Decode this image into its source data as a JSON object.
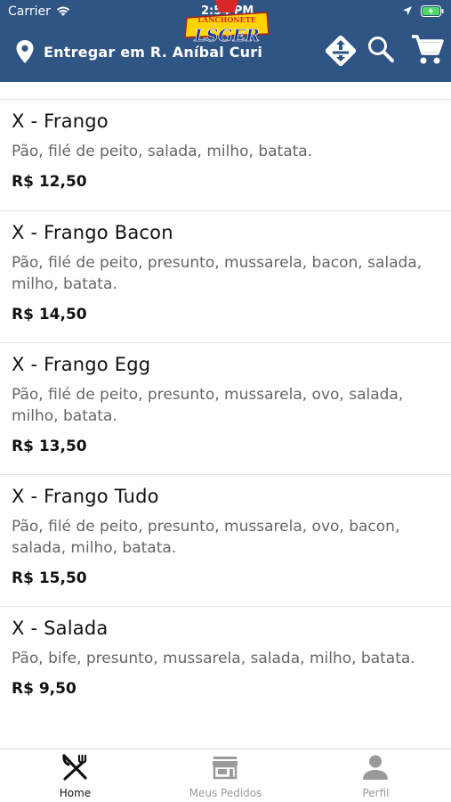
{
  "status_bar": {
    "carrier": "Carrier",
    "time": "2:54 PM"
  },
  "brand": {
    "logo_top": "LANCHONETE",
    "logo_bottom": "LSGER",
    "accent": "#2f5584",
    "logo_red": "#d62828",
    "logo_yellow": "#ffd400"
  },
  "header": {
    "address": "Entregar em R. Aníbal Curi"
  },
  "items": [
    {
      "title": "X - Frango",
      "desc": "Pão, filé de peito, salada, milho, batata.",
      "price": "R$ 12,50"
    },
    {
      "title": "X - Frango Bacon",
      "desc": "Pão, filé de peito, presunto, mussarela, bacon, salada, milho, batata.",
      "price": "R$ 14,50"
    },
    {
      "title": "X - Frango Egg",
      "desc": "Pão, filé de peito, presunto, mussarela, ovo, salada, milho, batata.",
      "price": "R$ 13,50"
    },
    {
      "title": "X - Frango Tudo",
      "desc": "Pão, filé de peito, presunto, mussarela, ovo, bacon, salada, milho, batata.",
      "price": "R$ 15,50"
    },
    {
      "title": "X - Salada",
      "desc": "Pão, bife, presunto, mussarela, salada, milho, batata.",
      "price": "R$ 9,50"
    }
  ],
  "tabs": [
    {
      "label": "Home",
      "icon": "utensils-icon",
      "active": true
    },
    {
      "label": "Meus Pedidos",
      "icon": "store-icon",
      "active": false
    },
    {
      "label": "Perfil",
      "icon": "person-icon",
      "active": false
    }
  ]
}
